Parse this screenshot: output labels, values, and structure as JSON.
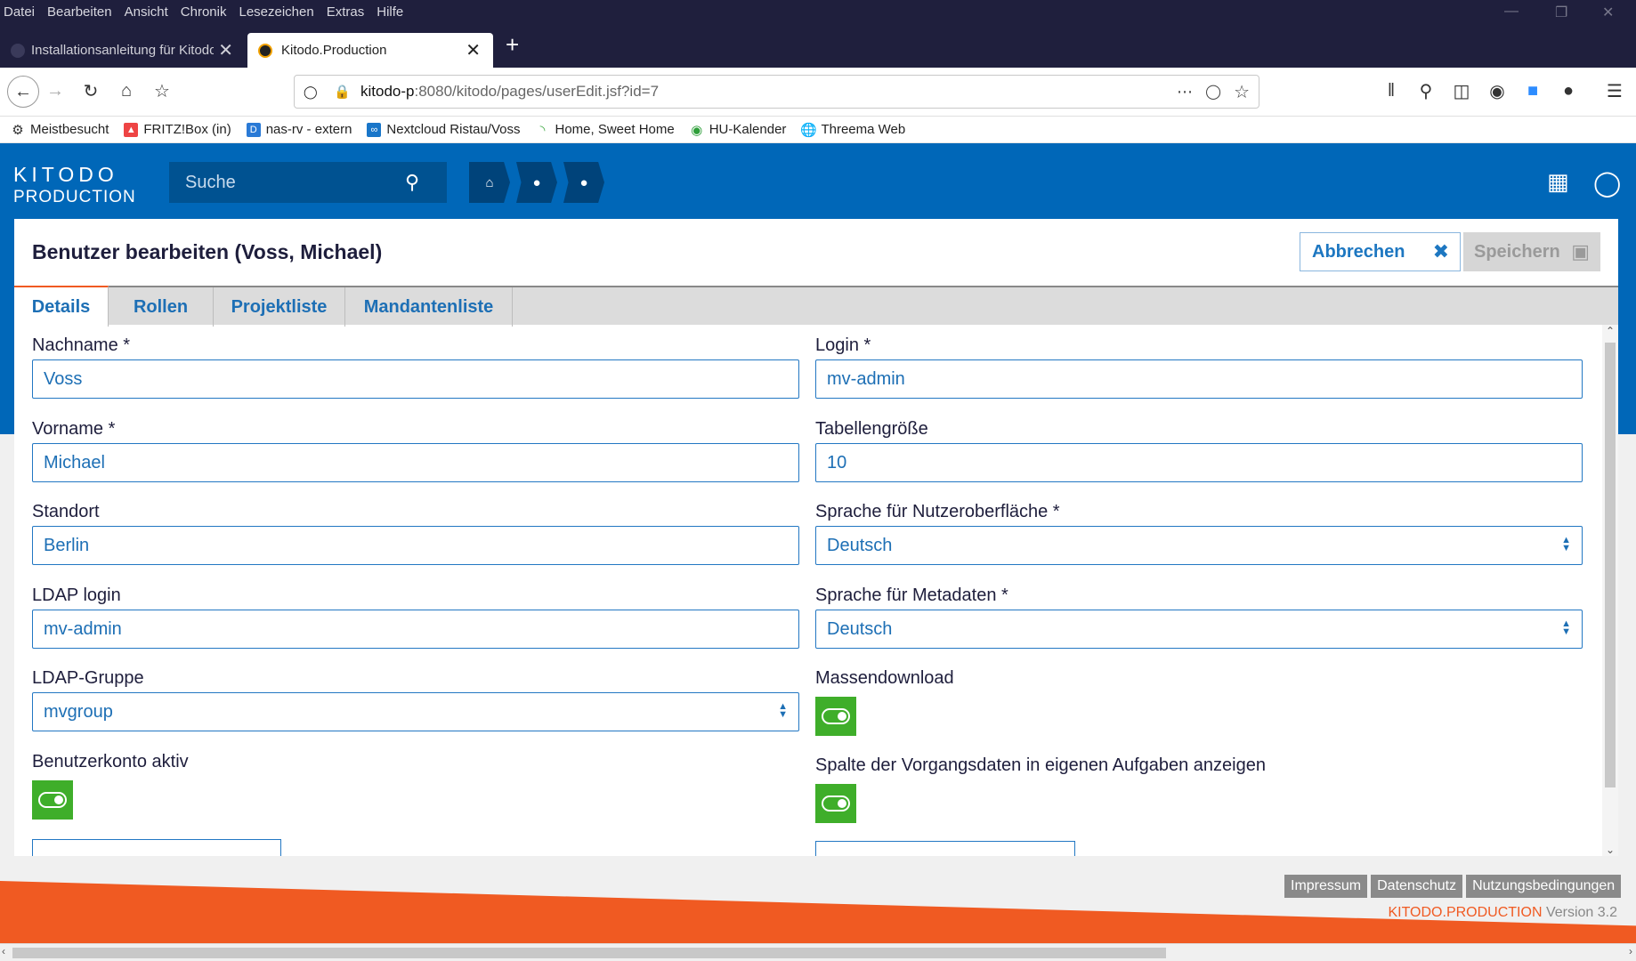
{
  "browser": {
    "menu": [
      "Datei",
      "Bearbeiten",
      "Ansicht",
      "Chronik",
      "Lesezeichen",
      "Extras",
      "Hilfe"
    ],
    "tabs": [
      {
        "title": "Installationsanleitung für Kitodo"
      },
      {
        "title": "Kitodo.Production"
      }
    ],
    "url_host": "kitodo-p",
    "url_rest": ":8080/kitodo/pages/userEdit.jsf?id=7",
    "bookmarks": [
      "Meistbesucht",
      "FRITZ!Box (in)",
      "nas-rv - extern",
      "Nextcloud Ristau/Voss",
      "Home, Sweet Home",
      "HU-Kalender",
      "Threema Web"
    ]
  },
  "app": {
    "logo_top": "KITODO",
    "logo_bottom": "PRODUCTION",
    "search_placeholder": "Suche",
    "title": "Benutzer bearbeiten (Voss, Michael)",
    "cancel_label": "Abbrechen",
    "save_label": "Speichern",
    "tabs": [
      "Details",
      "Rollen",
      "Projektliste",
      "Mandantenliste"
    ],
    "fields": {
      "nachname": {
        "label": "Nachname *",
        "value": "Voss"
      },
      "vorname": {
        "label": "Vorname *",
        "value": "Michael"
      },
      "standort": {
        "label": "Standort",
        "value": "Berlin"
      },
      "ldap_login": {
        "label": "LDAP login",
        "value": "mv-admin"
      },
      "ldap_gruppe": {
        "label": "LDAP-Gruppe",
        "value": "mvgroup"
      },
      "konto_aktiv": {
        "label": "Benutzerkonto aktiv",
        "on": true
      },
      "login": {
        "label": "Login *",
        "value": "mv-admin"
      },
      "tabellengroesse": {
        "label": "Tabellengröße",
        "value": "10"
      },
      "sprache_ui": {
        "label": "Sprache für Nutzeroberfläche *",
        "value": "Deutsch"
      },
      "sprache_meta": {
        "label": "Sprache für Metadaten *",
        "value": "Deutsch"
      },
      "massendownload": {
        "label": "Massendownload",
        "on": true
      },
      "vorgangsdaten": {
        "label": "Spalte der Vorgangsdaten in eigenen Aufgaben anzeigen",
        "on": true
      }
    },
    "footer": {
      "links": [
        "Impressum",
        "Datenschutz",
        "Nutzungsbedingungen"
      ],
      "brand": "KITODO.PRODUCTION",
      "version": " Version 3.2"
    },
    "colors": {
      "primary": "#0067b8",
      "accent": "#f05a22",
      "toggle_on": "#3fae2a"
    }
  }
}
